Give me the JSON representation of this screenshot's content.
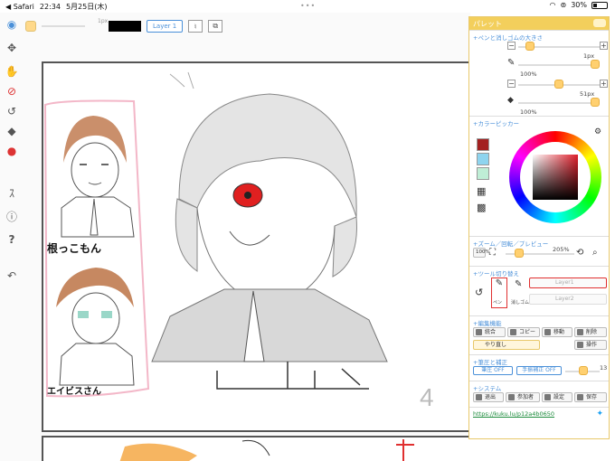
{
  "statusbar": {
    "back_app": "◀ Safari",
    "time": "22:34",
    "date": "5月25日(木)",
    "dots": "•••",
    "battery": "30%",
    "battery_level": 0.3
  },
  "toolbar": {
    "size_value": "1px",
    "layer_label": "Layer 1"
  },
  "canvas": {
    "caption_top": "根っこもん",
    "caption_bottom": "エイビスさん",
    "page_number": "4"
  },
  "panel": {
    "title": "パレット",
    "sections": {
      "pen_size": "+ペンと消しゴムの大きさ",
      "color_picker": "+カラーピッカー",
      "zoom": "+ズーム／回転／プレビュー",
      "tool_switch": "+ツール切り替え",
      "edit": "+編集機能",
      "stroke": "+筆圧と補正",
      "system": "+システム"
    },
    "pen": {
      "size": "1px",
      "opacity": "100%",
      "size_level": 0.1,
      "opacity_level": 1.0
    },
    "eraser": {
      "size": "51px",
      "opacity": "100%",
      "size_level": 0.5,
      "opacity_level": 1.0
    },
    "colors": {
      "chip1": "#a32020",
      "chip2": "#8ed4ef",
      "chip3": "#bfeed6"
    },
    "zoom": {
      "zoom_btn": "100%",
      "zoom_value": "205%",
      "zoom_level": 0.15
    },
    "tools": {
      "pen_label": "ペン",
      "eraser_label": "消しゴム",
      "round_label": "円形",
      "layer1": "Layer1",
      "layer2": "Layer2"
    },
    "edit": {
      "merge": "統合",
      "copy": "コピー",
      "move": "移動",
      "delete": "削除",
      "redo": "やり直し",
      "operation": "操作"
    },
    "stroke": {
      "pressure": "筆圧 OFF",
      "correction": "手振補正 OFF",
      "value": "13",
      "level": 0.55
    },
    "system": {
      "exit": "退出",
      "participants": "参加者",
      "settings": "設定",
      "save": "保存"
    },
    "link": "https://kuku.lu/p12a4b0650"
  }
}
